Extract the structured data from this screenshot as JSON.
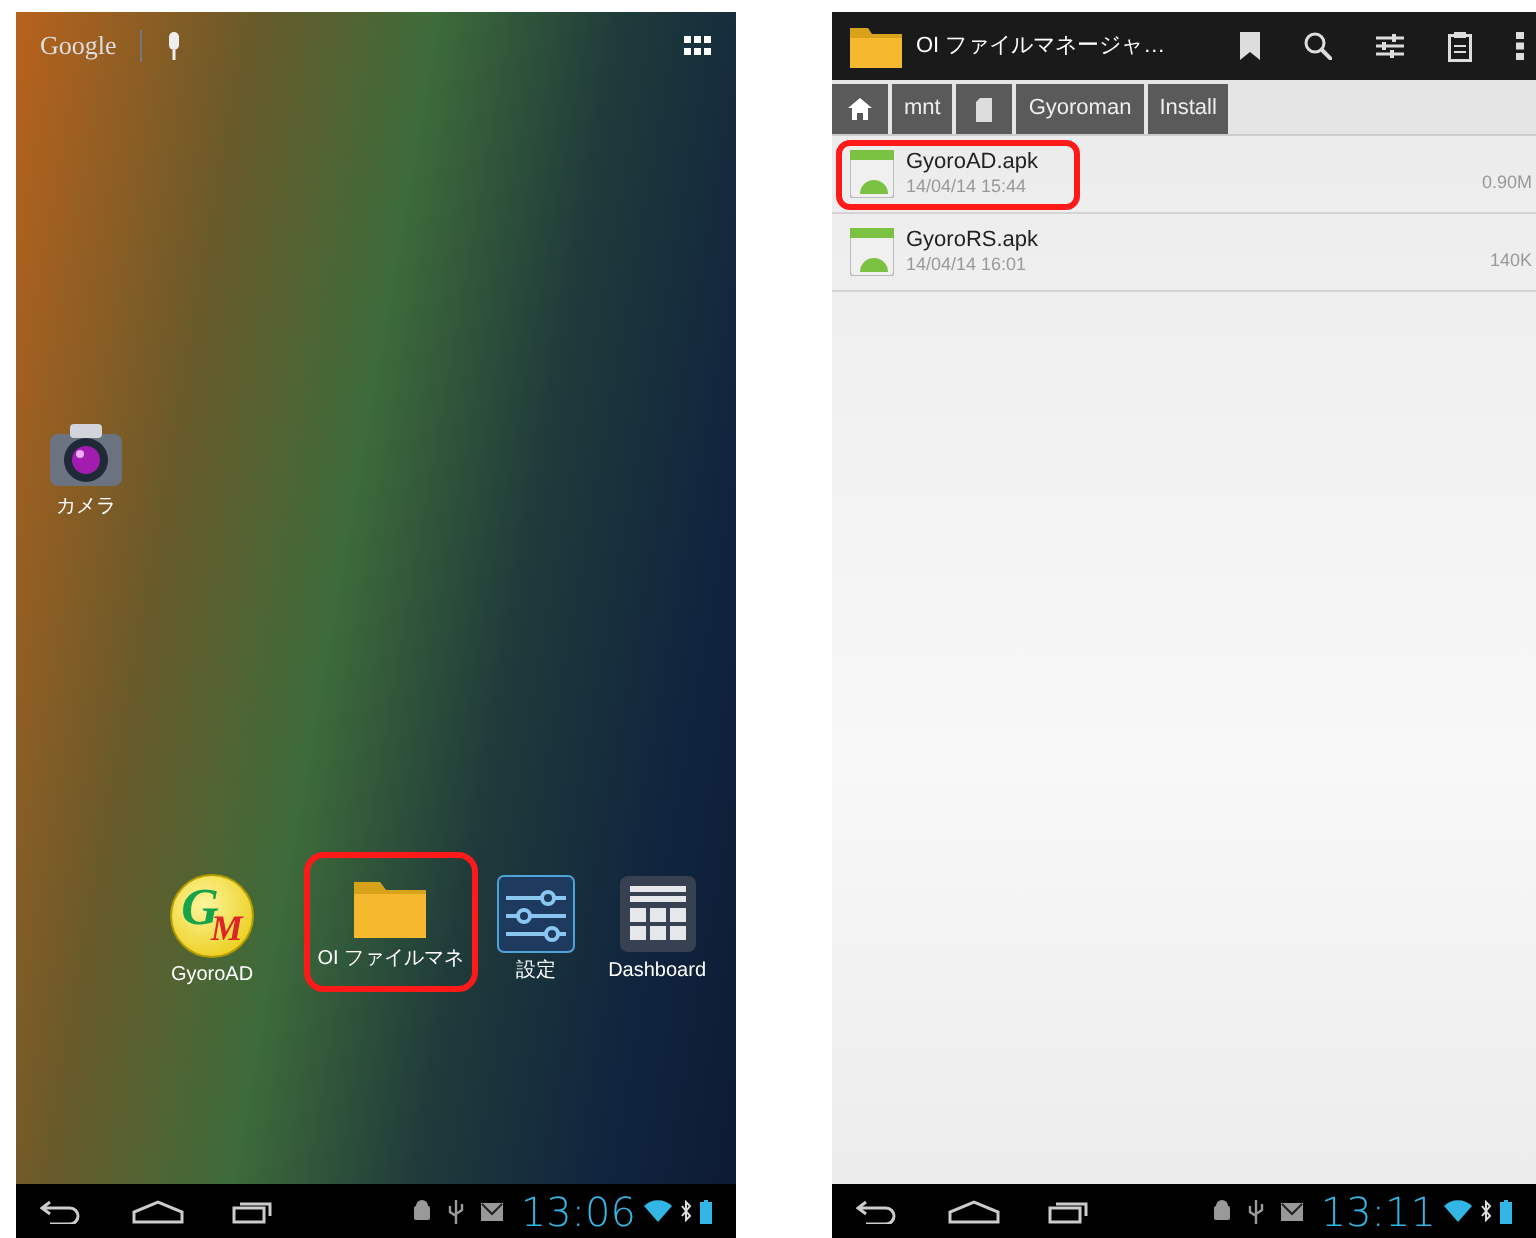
{
  "home_screen": {
    "search_bar": {
      "label": "Google"
    },
    "desktop_icons": [
      {
        "kind": "camera",
        "label": "カメラ",
        "highlighted": false
      }
    ],
    "bottom_row_icons": [
      {
        "kind": "gm-logo",
        "label": "GyoroAD",
        "logo_letters": [
          "G",
          "M"
        ],
        "highlighted": false
      },
      {
        "kind": "folder",
        "label": "OI ファイルマネ",
        "highlighted": true
      },
      {
        "kind": "settings",
        "label": "設定",
        "highlighted": false
      },
      {
        "kind": "dashboard",
        "label": "Dashboard",
        "highlighted": false
      }
    ],
    "status_bar": {
      "time": "13:06"
    }
  },
  "file_manager": {
    "title": "OI ファイルマネージャ…",
    "breadcrumb": [
      {
        "kind": "home"
      },
      {
        "kind": "text",
        "label": "mnt"
      },
      {
        "kind": "sdcard"
      },
      {
        "kind": "text",
        "label": "Gyoroman"
      },
      {
        "kind": "text",
        "label": "Install"
      }
    ],
    "files": [
      {
        "name": "GyoroAD.apk",
        "date": "14/04/14 15:44",
        "size": "0.90M",
        "highlighted": true
      },
      {
        "name": "GyoroRS.apk",
        "date": "14/04/14 16:01",
        "size": "140K",
        "highlighted": false
      }
    ],
    "status_bar": {
      "time": "13:11"
    }
  }
}
